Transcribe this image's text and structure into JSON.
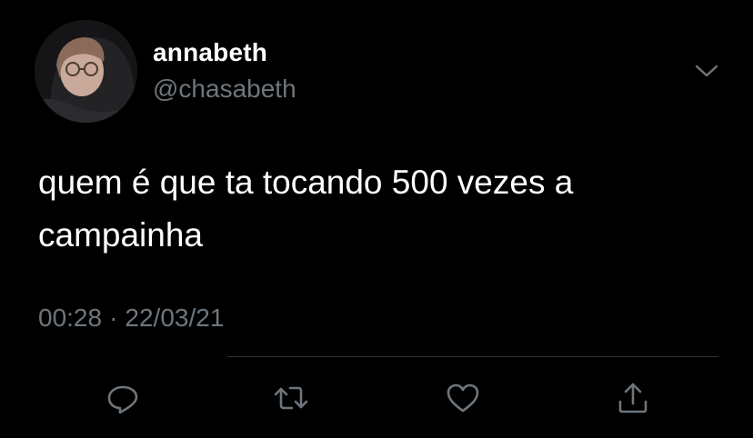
{
  "tweet": {
    "display_name": "annabeth",
    "handle": "@chasabeth",
    "text": "quem é que ta tocando 500 vezes a campainha",
    "time": "00:28",
    "separator": "·",
    "date": "22/03/21"
  },
  "icons": {
    "menu": "chevron-down-icon",
    "reply": "reply-icon",
    "retweet": "retweet-icon",
    "like": "heart-icon",
    "share": "share-icon"
  },
  "colors": {
    "background": "#000000",
    "primary_text": "#ffffff",
    "secondary_text": "#6e767d",
    "divider": "#2f3336"
  }
}
